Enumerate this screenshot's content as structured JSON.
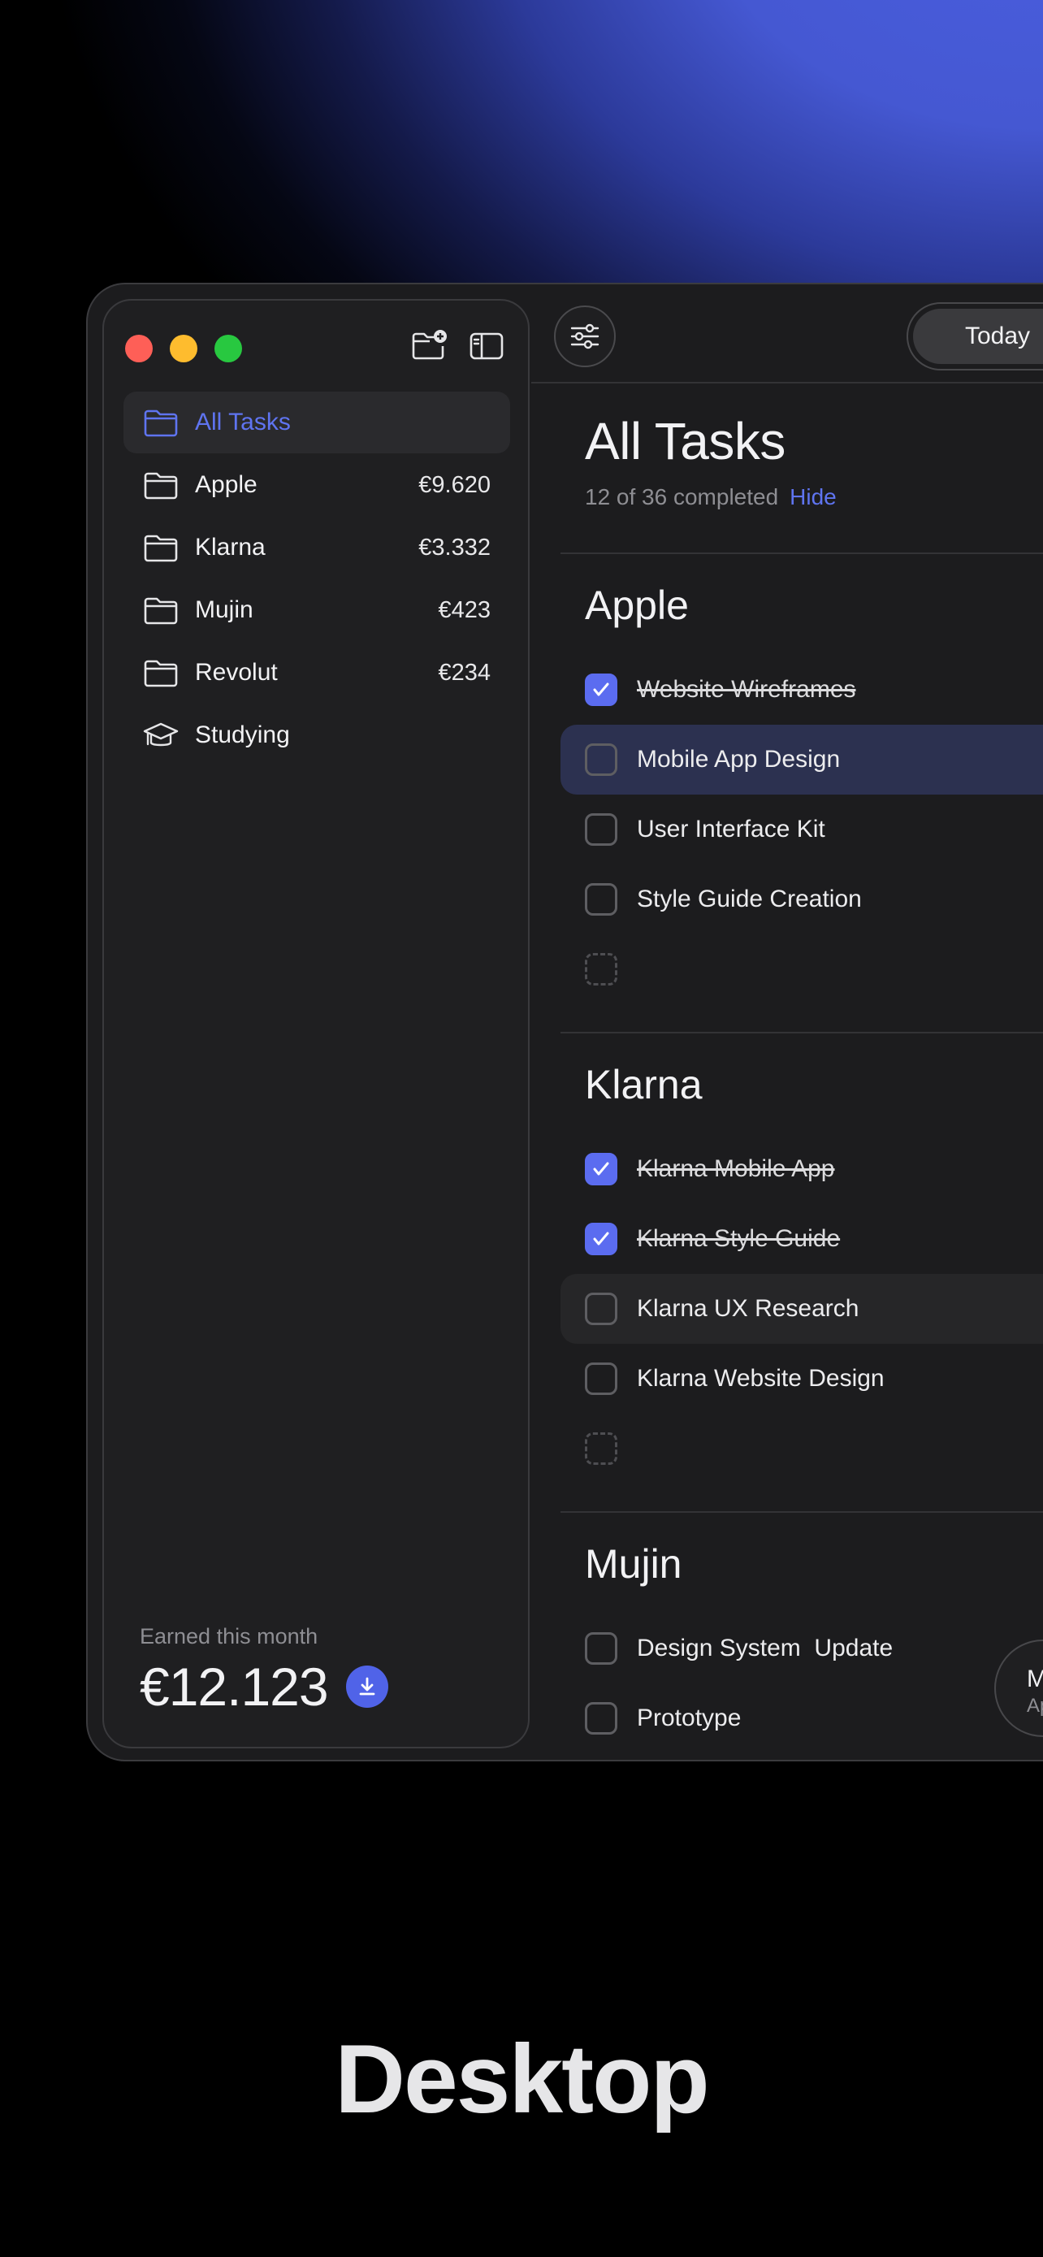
{
  "sidebar": {
    "items": [
      {
        "label": "All Tasks",
        "amount": "",
        "icon": "folder-icon"
      },
      {
        "label": "Apple",
        "amount": "€9.620",
        "icon": "folder-icon"
      },
      {
        "label": "Klarna",
        "amount": "€3.332",
        "icon": "folder-icon"
      },
      {
        "label": "Mujin",
        "amount": "€423",
        "icon": "folder-icon"
      },
      {
        "label": "Revolut",
        "amount": "€234",
        "icon": "folder-icon"
      },
      {
        "label": "Studying",
        "amount": "",
        "icon": "graduation-cap-icon"
      }
    ],
    "earned_label": "Earned this month",
    "earned_value": "€12.123"
  },
  "toolbar": {
    "today_label": "Today"
  },
  "main": {
    "title": "All Tasks",
    "progress": "12 of 36 completed",
    "hide_label": "Hide",
    "sections": [
      {
        "title": "Apple",
        "tasks": [
          {
            "label": "Website Wireframes",
            "done": true
          },
          {
            "label": "Mobile App Design",
            "done": false
          },
          {
            "label": "User Interface Kit",
            "done": false
          },
          {
            "label": "Style Guide Creation",
            "done": false
          }
        ]
      },
      {
        "title": "Klarna",
        "tasks": [
          {
            "label": "Klarna Mobile App",
            "done": true
          },
          {
            "label": "Klarna Style Guide",
            "done": true
          },
          {
            "label": "Klarna UX Research",
            "done": false
          },
          {
            "label": "Klarna Website Design",
            "done": false
          }
        ]
      },
      {
        "title": "Mujin",
        "tasks": [
          {
            "label": "Design System  Update",
            "done": false
          },
          {
            "label": "Prototype",
            "done": false
          }
        ]
      }
    ],
    "floating_button": {
      "line1": "M",
      "line2": "Ap"
    }
  },
  "caption": "Desktop",
  "colors": {
    "accent": "#5b6cf0",
    "window_bg": "#1c1c1e",
    "highlight_row": "#2c3150"
  }
}
